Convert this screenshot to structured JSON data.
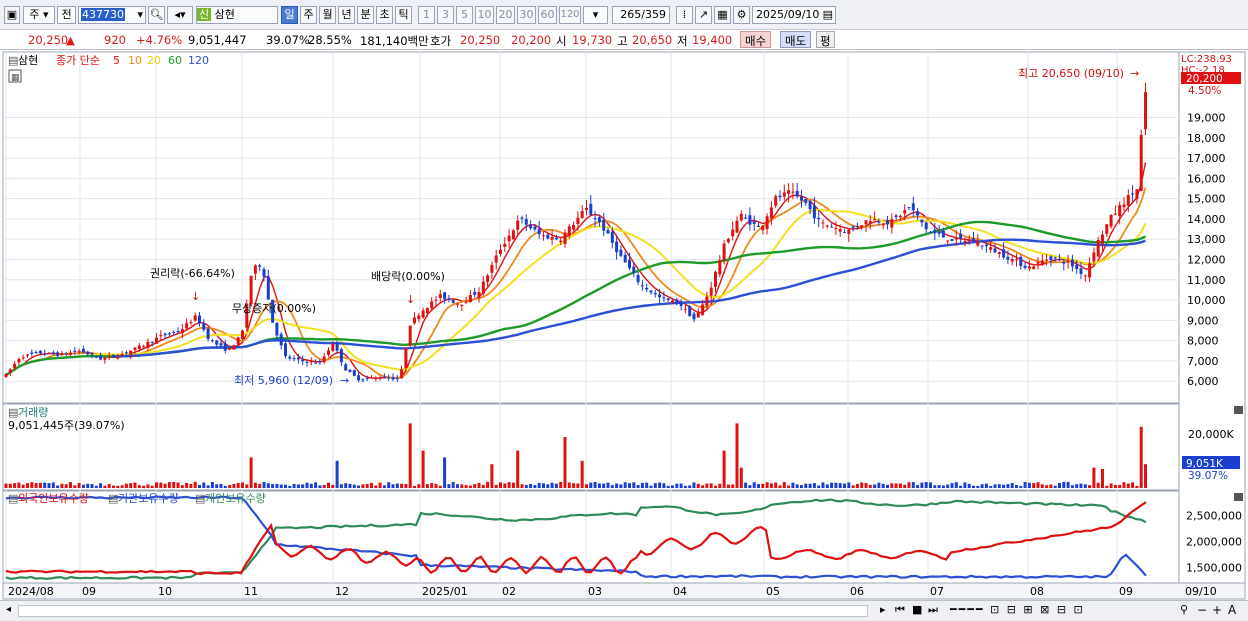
{
  "toolbar": {
    "market_label": "주",
    "prev_label": "전",
    "code": "437730",
    "new_badge": "신",
    "stock_name": "삼현",
    "periods": [
      "일",
      "주",
      "월",
      "년",
      "분",
      "초",
      "틱"
    ],
    "active_period": "일",
    "intervals": [
      "1",
      "3",
      "5",
      "10",
      "20",
      "30",
      "60",
      "120"
    ],
    "count": "265",
    "total": "/359",
    "date": "2025/09/10"
  },
  "info": {
    "price": "20,250",
    "arrow": "▲",
    "change": "920",
    "change_pct": "+4.76%",
    "volume": "9,051,447",
    "vol_ratio": "39.07%",
    "turnover": "28.55%",
    "amount": "181,140백만",
    "bid_label": "호가",
    "bid1": "20,250",
    "bid2": "20,200",
    "open_label": "시",
    "open": "19,730",
    "high_label": "고",
    "high": "20,650",
    "low_label": "저",
    "low": "19,400",
    "buy_label": "매수",
    "sell_label": "매도",
    "extra_label": "평"
  },
  "price_panel": {
    "title": "삼현",
    "legend": [
      "종가 단순",
      "5",
      "10",
      "20",
      "60",
      "120"
    ],
    "lc": "LC:238.93",
    "hc": "HC:-2.18",
    "cur_price": "20,200",
    "cur_pct": "4.50%",
    "y_ticks": [
      "19,000",
      "18,000",
      "17,000",
      "16,000",
      "15,000",
      "14,000",
      "13,000",
      "12,000",
      "11,000",
      "10,000",
      "9,000",
      "8,000",
      "7,000",
      "6,000"
    ],
    "ann_high": "최고 20,650 (09/10)",
    "ann_low": "최저 5,960 (12/09)",
    "ann_rights": "권리락(-66.64%)",
    "ann_bonus": "무상증자(0.00%)",
    "ann_div": "배당락(0.00%)"
  },
  "volume_panel": {
    "title": "거래량",
    "value": "9,051,445주(39.07%)",
    "y_tick": "20,000K",
    "cur_value": "9,051K",
    "cur_pct": "39.07%"
  },
  "holding_panel": {
    "labels": [
      "외국인보유수량",
      "기관보유수량",
      "개인보유수량"
    ],
    "y_ticks": [
      "2,500,000",
      "2,000,000",
      "1,500,000"
    ]
  },
  "x_axis": [
    "2024/08",
    "09",
    "10",
    "11",
    "12",
    "2025/01",
    "02",
    "03",
    "04",
    "05",
    "06",
    "07",
    "08",
    "09"
  ],
  "x_axis_last": "09/10",
  "colors": {
    "up": "#e01010",
    "down": "#1a3fd0",
    "ma5": "#e01010",
    "ma10": "#f08a1a",
    "ma20": "#f2e020",
    "ma60": "#1e9a2a",
    "ma120": "#2b4fd6",
    "foreign": "#e01010",
    "institution": "#2b4fd6",
    "individual": "#2e8b57"
  }
}
